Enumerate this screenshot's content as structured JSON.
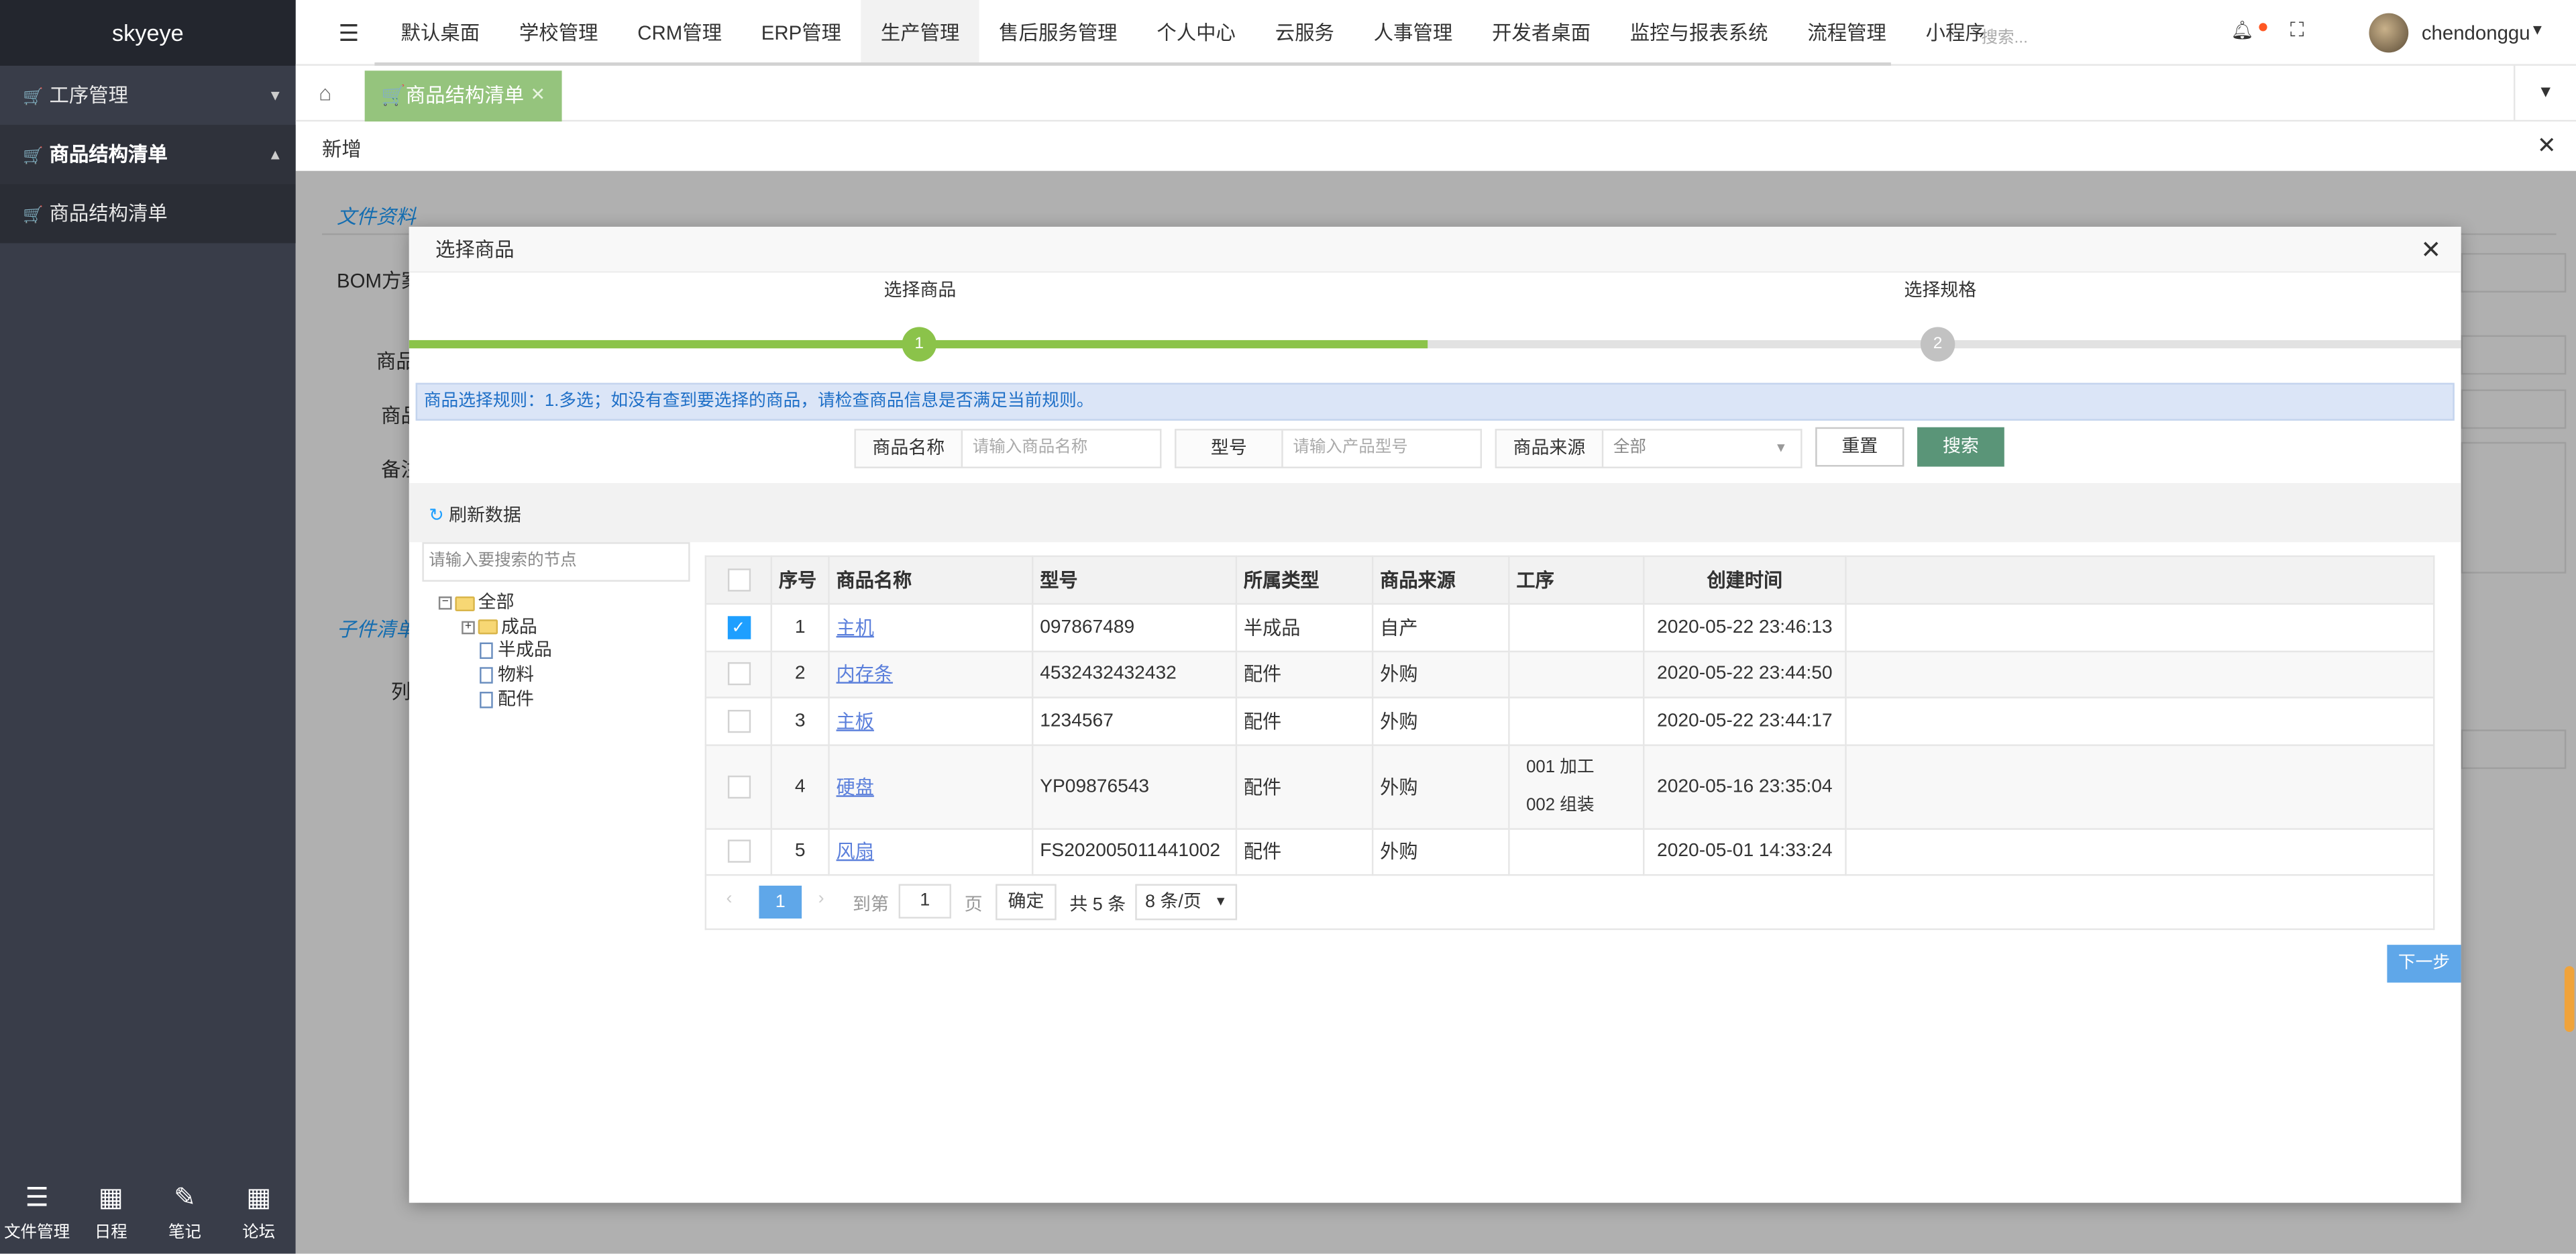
{
  "app": {
    "name": "skyeye"
  },
  "sidebar": {
    "items": [
      {
        "label": "工序管理"
      },
      {
        "label": "商品结构清单"
      },
      {
        "label": "商品结构清单"
      }
    ],
    "bottom": [
      {
        "label": "文件管理"
      },
      {
        "label": "日程"
      },
      {
        "label": "笔记"
      },
      {
        "label": "论坛"
      }
    ]
  },
  "topnav": {
    "items": [
      "默认桌面",
      "学校管理",
      "CRM管理",
      "ERP管理",
      "生产管理",
      "售后服务管理",
      "个人中心",
      "云服务",
      "人事管理",
      "开发者桌面",
      "监控与报表系统",
      "流程管理",
      "小程序"
    ],
    "active_index": 4,
    "search_placeholder": "搜索...",
    "username": "chendonggua"
  },
  "tabs": [
    {
      "label": "商品结构清单"
    }
  ],
  "subpanel": {
    "title": "新增",
    "bg_section1": "文件资料",
    "bg_label1": "BOM方案",
    "bg_label2": "商品",
    "bg_label3": "商品",
    "bg_label4": "备注",
    "bg_section2": "子件清单",
    "bg_label5": "列"
  },
  "modal": {
    "title": "选择商品",
    "steps": [
      {
        "label": "选择商品",
        "number": "1"
      },
      {
        "label": "选择规格",
        "number": "2"
      }
    ],
    "rule_text": "商品选择规则：1.多选；如没有查到要选择的商品，请检查商品信息是否满足当前规则。",
    "filters": {
      "name_label": "商品名称",
      "name_placeholder": "请输入商品名称",
      "model_label": "型号",
      "model_placeholder": "请输入产品型号",
      "source_label": "商品来源",
      "source_value": "全部"
    },
    "reset_label": "重置",
    "search_label": "搜索",
    "refresh_label": "刷新数据",
    "tree_search_placeholder": "请输入要搜索的节点",
    "tree": {
      "root": "全部",
      "children": [
        "成品",
        "半成品",
        "物料",
        "配件"
      ]
    },
    "table": {
      "headers": [
        "序号",
        "商品名称",
        "型号",
        "所属类型",
        "商品来源",
        "工序",
        "创建时间"
      ],
      "rows": [
        {
          "checked": true,
          "no": "1",
          "name": "主机",
          "model": "097867489",
          "type": "半成品",
          "source": "自产",
          "process": [
            "",
            ""
          ],
          "created": "2020-05-22 23:46:13"
        },
        {
          "checked": false,
          "no": "2",
          "name": "内存条",
          "model": "4532432432432",
          "type": "配件",
          "source": "外购",
          "process": [
            "",
            ""
          ],
          "created": "2020-05-22 23:44:50"
        },
        {
          "checked": false,
          "no": "3",
          "name": "主板",
          "model": "1234567",
          "type": "配件",
          "source": "外购",
          "process": [
            "",
            ""
          ],
          "created": "2020-05-22 23:44:17"
        },
        {
          "checked": false,
          "no": "4",
          "name": "硬盘",
          "model": "YP09876543",
          "type": "配件",
          "source": "外购",
          "process": [
            "001 加工",
            "002 组装"
          ],
          "created": "2020-05-16 23:35:04"
        },
        {
          "checked": false,
          "no": "5",
          "name": "风扇",
          "model": "FS202005011441002",
          "type": "配件",
          "source": "外购",
          "process": [
            "",
            ""
          ],
          "created": "2020-05-01 14:33:24"
        }
      ]
    },
    "pager": {
      "current": "1",
      "goto_label": "到第",
      "goto_value": "1",
      "page_unit": "页",
      "confirm": "确定",
      "total": "共 5 条",
      "size": "8 条/页"
    },
    "next_label": "下一步"
  }
}
